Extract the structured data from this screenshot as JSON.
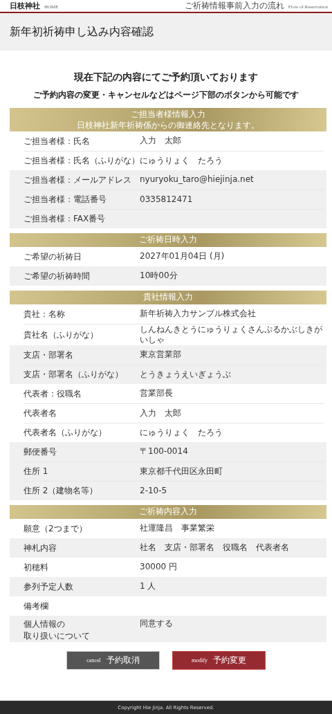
{
  "header": {
    "logo": "日枝神社",
    "home_link": "HOME",
    "flow_link": "ご祈祷情報事前入力の流れ",
    "flow_link_en": "Flow of Reservation"
  },
  "page_title": "新年初祈祷申し込み内容確認",
  "heading": "現在下記の内容にてご予約頂いております",
  "subheading": "ご予約内容の変更・キャンセルなどはページ下部のボタンから可能です",
  "sections": [
    {
      "title": "ご担当者様情報入力",
      "note": "日枝神社新年祈祷係からの御連絡先となります。",
      "groups": [
        [
          {
            "label": "ご担当者様：氏名",
            "value": "入力　太郎"
          },
          {
            "label": "ご担当者様：氏名（ふりがな）",
            "value": "にゅうりょく　たろう"
          }
        ],
        [
          {
            "label": "ご担当者様：メールアドレス",
            "value": "nyuryoku_taro@hiejinja.net"
          },
          {
            "label": "ご担当者様：電話番号",
            "value": "0335812471"
          },
          {
            "label": "ご担当者様：FAX番号"
          }
        ]
      ]
    },
    {
      "title": "ご祈祷日時入力",
      "groups": [
        [
          {
            "label": "ご希望の祈祷日",
            "value": "2027年01月04日 (月)"
          }
        ],
        [
          {
            "label": "ご希望の祈祷時間",
            "value": "10時00分"
          }
        ]
      ]
    },
    {
      "title": "貴社情報入力",
      "groups": [
        [
          {
            "label": "貴社：名称",
            "value": "新年祈祷入力サンプル株式会社"
          },
          {
            "label": "貴社名（ふりがな）",
            "value": "しんねんきとうにゅうりょくさんぷるかぶしきがいしゃ"
          }
        ],
        [
          {
            "label": "支店・部署名",
            "value": "東京営業部"
          },
          {
            "label": "支店・部署名（ふりがな）",
            "value": "とうきょうえいぎょうぶ"
          }
        ],
        [
          {
            "label": "代表者：役職名",
            "value": "営業部長"
          },
          {
            "label": "代表者名",
            "value": "入力　太郎"
          },
          {
            "label": "代表者名（ふりがな）",
            "value": "にゅうりょく　たろう"
          }
        ],
        [
          {
            "label": "郵便番号",
            "value": "〒100-0014"
          },
          {
            "label": "住所 1",
            "value": "東京都千代田区永田町"
          },
          {
            "label": "住所 2（建物名等）",
            "value": "2-10-5"
          }
        ]
      ]
    },
    {
      "title": "ご祈祷内容入力",
      "groups": [
        [
          {
            "label": "願意（2つまで）",
            "value": "社運隆昌　事業繁栄"
          }
        ],
        [
          {
            "label": "神札内容",
            "value": "社名　支店・部署名　役職名　代表者名"
          }
        ],
        [
          {
            "label": "初穂料",
            "value": "30000 円"
          }
        ],
        [
          {
            "label": "参列予定人数",
            "value": "1 人"
          }
        ],
        [
          {
            "label": "備考欄"
          }
        ],
        [
          {
            "label_lines": [
              "個人情報の",
              "取り扱いについて"
            ],
            "value": "同意する"
          }
        ]
      ]
    }
  ],
  "buttons": [
    {
      "kind": "cancel",
      "en": "cancel",
      "label": "予約取消"
    },
    {
      "kind": "modify",
      "en": "modify",
      "label": "予約変更"
    }
  ],
  "footer": "Copyright Hie Jinja. All Rights Reserved."
}
